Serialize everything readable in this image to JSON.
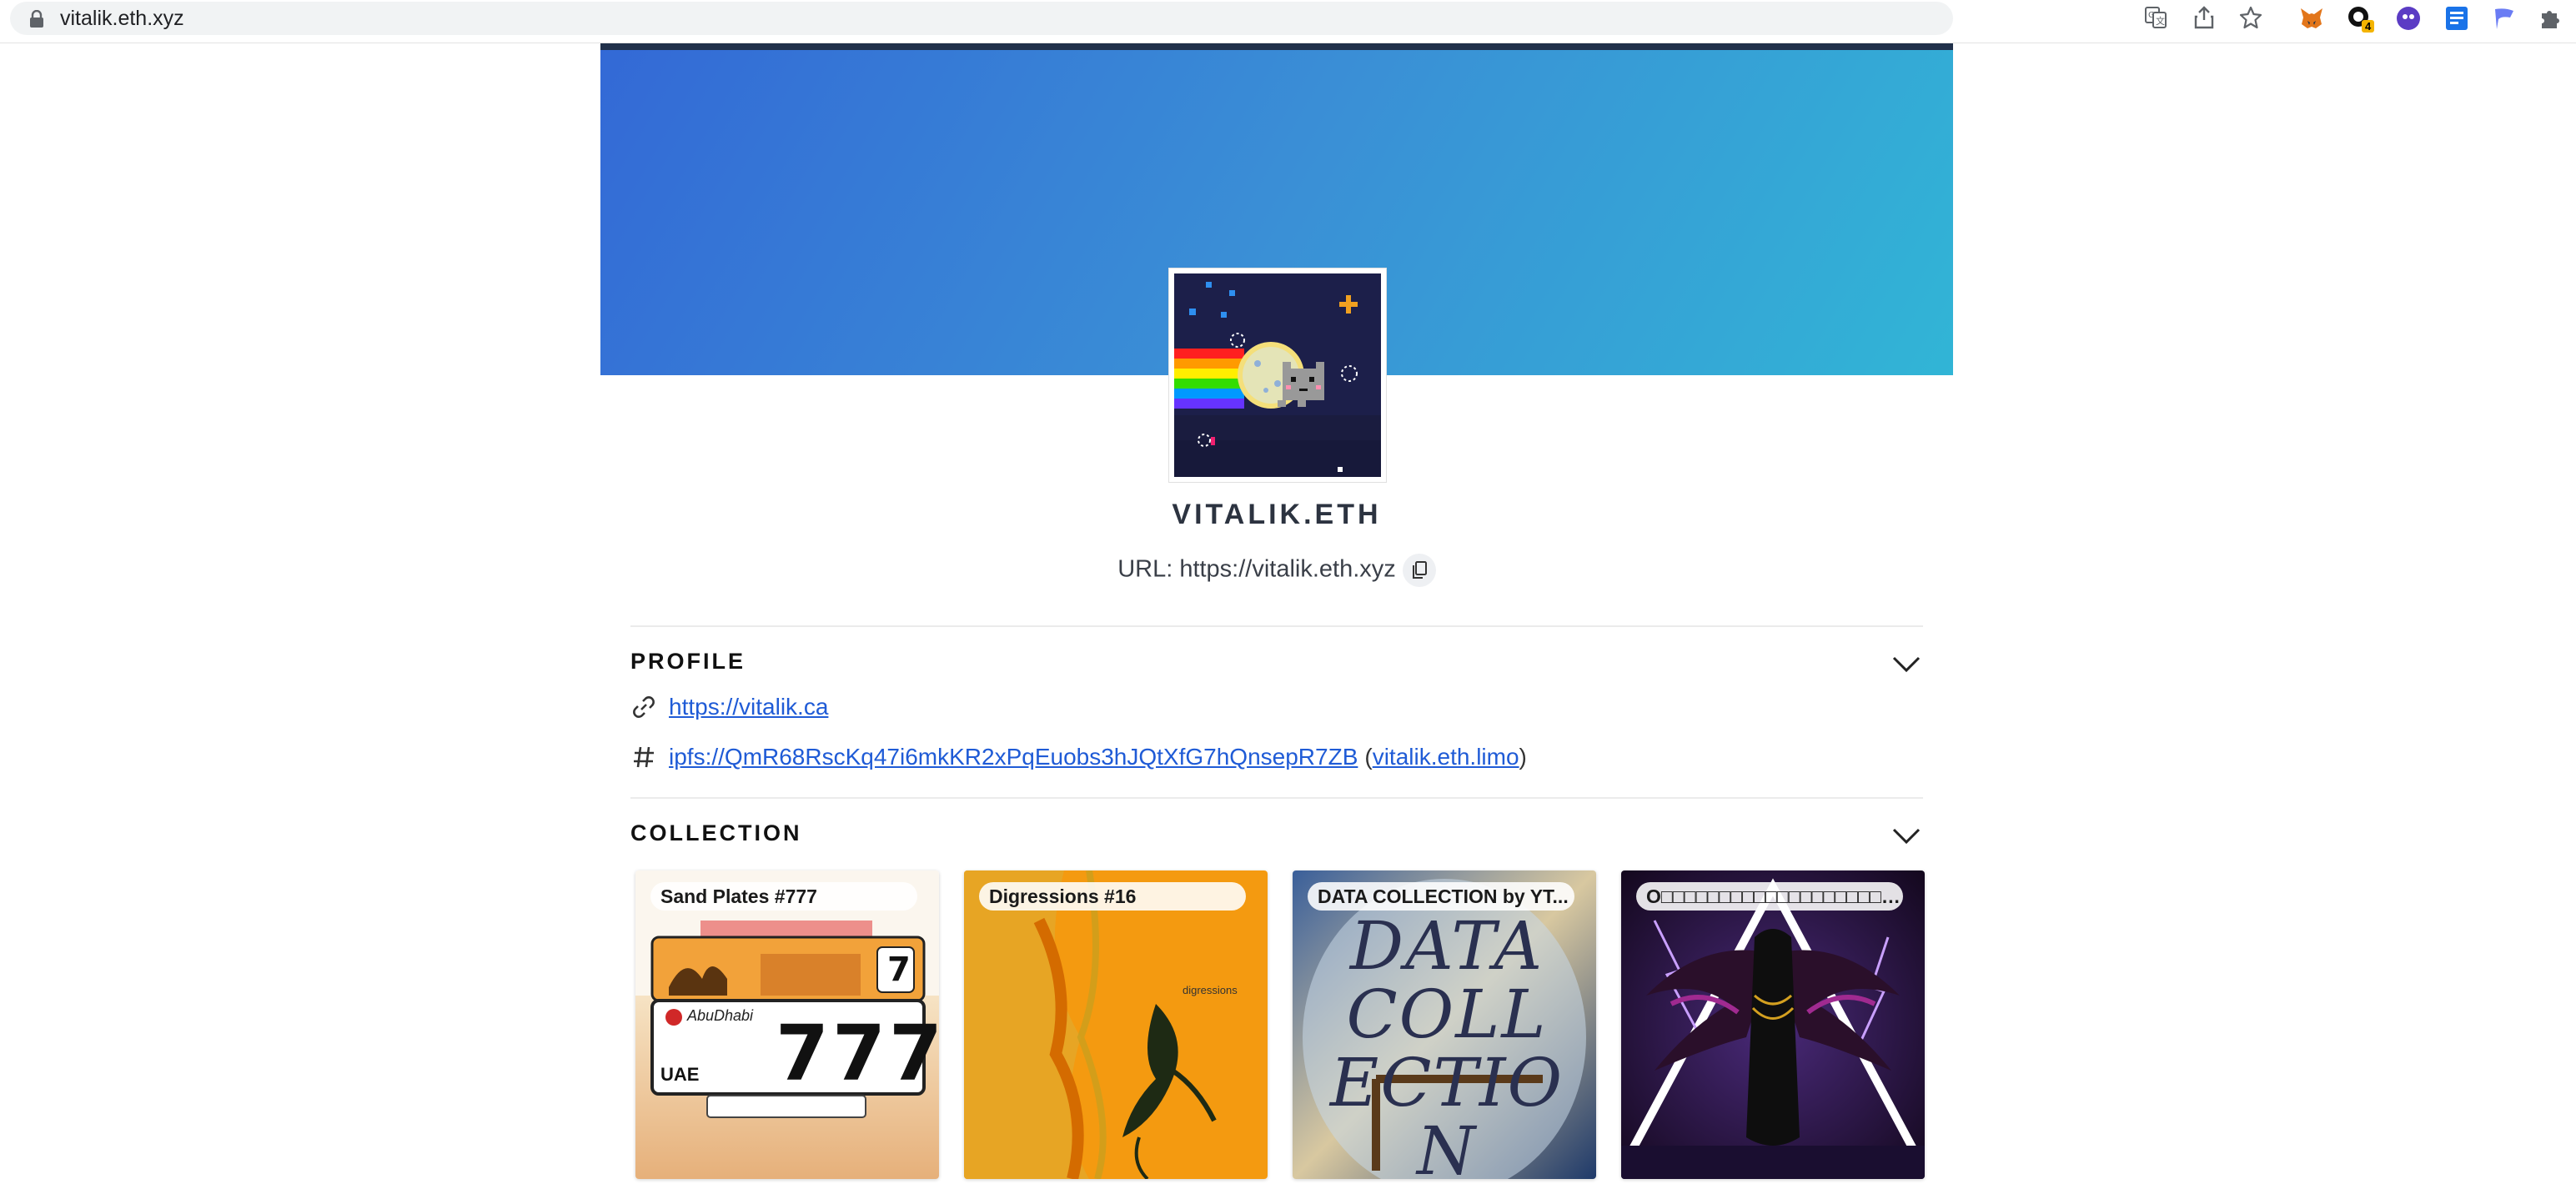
{
  "browser": {
    "url": "vitalik.eth.xyz",
    "extension_badge": "4"
  },
  "profile_header": {
    "name": "VITALIK.ETH",
    "url_label": "URL: https://vitalik.eth.xyz"
  },
  "profile_section": {
    "title": "PROFILE",
    "website": "https://vitalik.ca",
    "content_hash": "ipfs://QmR68RscKq47i6mkKR2xPqEuobs3hJQtXfG7hQnsepR7ZB",
    "limo_open": "(",
    "limo_link": "vitalik.eth.limo",
    "limo_close": ")"
  },
  "collection_section": {
    "title": "COLLECTION",
    "items": [
      {
        "label": "Sand Plates #777",
        "plate_number": "777",
        "plate_small": "7",
        "plate_country": "UAE",
        "plate_city": "AbuDhabi"
      },
      {
        "label": "Digressions #16",
        "caption": "digressions"
      },
      {
        "label": "DATA COLLECTION by YT...",
        "art_text": "DATA COLLECTION"
      },
      {
        "label": "O□□□□□□□□□□□□□□□□□□□□□□□□□□□"
      }
    ]
  },
  "colors": {
    "banner_start": "#3369d6",
    "banner_end": "#31b5d6",
    "link": "#1f5bd6",
    "heading": "#2c3340"
  }
}
